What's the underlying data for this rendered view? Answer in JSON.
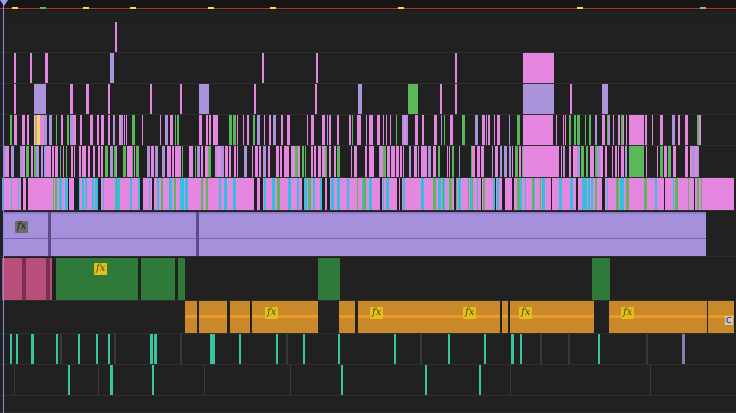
{
  "app": {
    "view": "sequence-timeline"
  },
  "colors": {
    "background": "#202020",
    "track_border": "#2e2e2e",
    "ruler_line": "#c0302c",
    "playhead": "#8a8ae8",
    "pink": "#e586e0",
    "violet": "#a994dc",
    "green": "#58b85a",
    "cyan": "#2fc1dd",
    "yellow": "#e6e44d",
    "audio_lavender": "#a68fdb",
    "audio_dark_green": "#2f7a38",
    "audio_rose": "#b84e7a",
    "audio_orange": "#c9892a",
    "audio_teal": "#37c5a0"
  },
  "effect_badges": [
    {
      "label": "fx"
    },
    {
      "label": "fx"
    },
    {
      "label": "fx"
    },
    {
      "label": "fx"
    },
    {
      "label": "fx"
    },
    {
      "label": "fx"
    },
    {
      "label": "fx"
    },
    {
      "label": "fx"
    }
  ],
  "clip_corner_label": "C",
  "icons": {
    "playhead": "playhead-triangle-icon"
  }
}
